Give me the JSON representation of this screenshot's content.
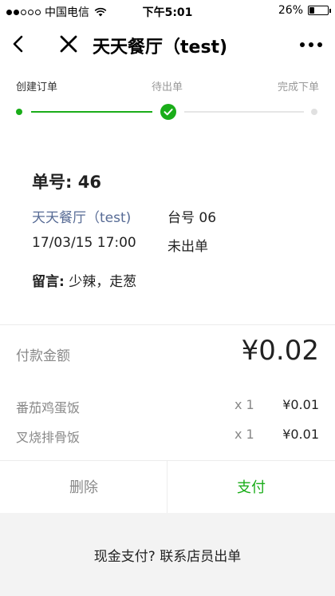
{
  "status_bar": {
    "carrier": "中国电信",
    "time": "下午5:01",
    "battery": "26%",
    "battery_level": 0.26
  },
  "nav": {
    "title": "天天餐厅（test)",
    "back_icon": "chevron-left-icon",
    "close_icon": "close-icon",
    "more_icon": "more-horizontal-icon"
  },
  "progress": {
    "steps": [
      {
        "label": "创建订单",
        "state": "done"
      },
      {
        "label": "待出单",
        "state": "current"
      },
      {
        "label": "完成下单",
        "state": "pending"
      }
    ],
    "accent": "#1aad19"
  },
  "order": {
    "number_label": "单号: 46",
    "restaurant": "天天餐厅（test)",
    "table": "台号 06",
    "datetime": "17/03/15 17:00",
    "status": "未出单",
    "note_label": "留言:",
    "note_text": " 少辣，走葱"
  },
  "payment": {
    "label": "付款金额",
    "amount": "¥0.02",
    "items": [
      {
        "name": "番茄鸡蛋饭",
        "qty": "x 1",
        "price": "¥0.01"
      },
      {
        "name": "叉烧排骨饭",
        "qty": "x 1",
        "price": "¥0.01"
      }
    ]
  },
  "actions": {
    "delete_label": "删除",
    "pay_label": "支付"
  },
  "footer": {
    "cash_text": "现金支付? 联系店员出单"
  }
}
